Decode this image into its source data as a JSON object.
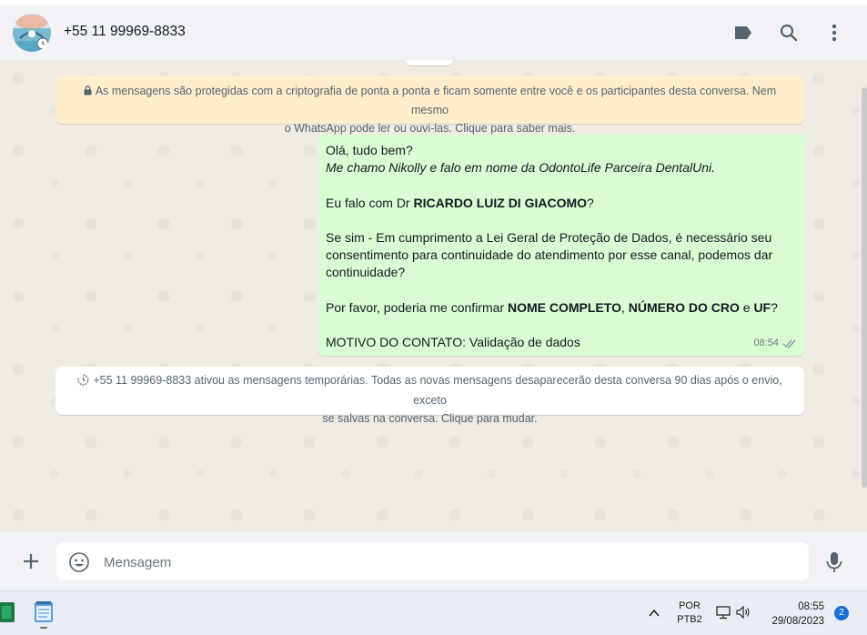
{
  "header": {
    "contact_name": "+55 11 99969-8833"
  },
  "encryption_notice": {
    "line1": "As mensagens são protegidas com a criptografia de ponta a ponta e ficam somente entre você e os participantes desta conversa. Nem mesmo",
    "line2": "o WhatsApp pode ler ou ouvi-las. Clique para saber mais."
  },
  "message": {
    "greeting": "Olá, tudo bem?",
    "intro": "Me chamo Nikolly e falo em nome da OdontoLife Parceira DentalUni.",
    "question_prefix": "Eu falo com Dr ",
    "doctor_name": "RICARDO LUIZ DI GIACOMO",
    "question_suffix": "?",
    "lgpd_text": "Se sim - Em cumprimento a Lei Geral de Proteção de Dados, é necessário seu consentimento para continuidade do atendimento por esse canal, podemos dar continuidade?",
    "confirm_prefix": "Por favor, poderia me confirmar ",
    "confirm_name": "NOME COMPLETO",
    "confirm_sep1": ", ",
    "confirm_cro": "NÚMERO DO CRO",
    "confirm_sep2": " e ",
    "confirm_uf": "UF",
    "confirm_suffix": "?",
    "reason": "MOTIVO DO CONTATO: Validação de dados",
    "time": "08:54"
  },
  "system_message": {
    "line1": "+55 11 99969-8833 ativou as mensagens temporárias. Todas as novas mensagens desaparecerão desta conversa 90 dias após o envio, exceto",
    "line2": "se salvas na conversa. Clique para mudar."
  },
  "composer": {
    "placeholder": "Mensagem"
  },
  "taskbar": {
    "lang_top": "POR",
    "lang_bottom": "PTB2",
    "time": "08:55",
    "date": "29/08/2023",
    "notification_count": "2"
  },
  "colors": {
    "outgoing_bubble": "#d9fdd3",
    "notice_bg": "#ffeecd",
    "chat_bg": "#efeae2",
    "header_bg": "#f0f2f5",
    "read_ticks": "#8696a0"
  }
}
